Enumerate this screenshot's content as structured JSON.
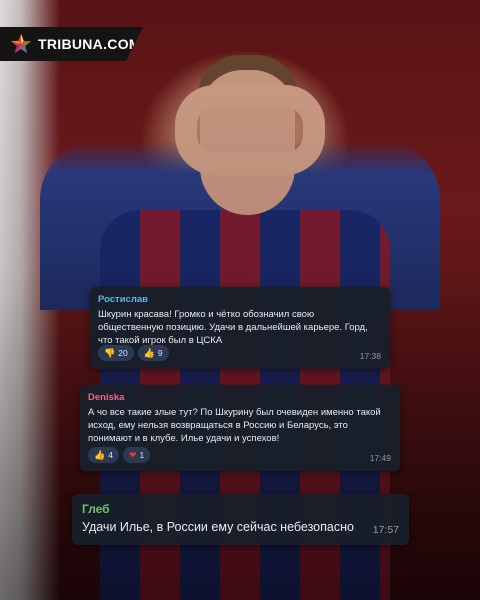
{
  "brand": {
    "name": "TRIBUNA.COM"
  },
  "messages": [
    {
      "author": "Ростислав",
      "author_color": "#5fb7e6",
      "text": "Шкурин красава! Громко и чётко обозначил свою общественную позицию. Удачи в дальнейшей карьере. Горд, что такой игрок был в ЦСКА",
      "reactions": [
        {
          "icon": "thumbs-down-icon",
          "glyph": "👎",
          "count": "20"
        },
        {
          "icon": "thumbs-up-icon",
          "glyph": "👍",
          "count": "9"
        }
      ],
      "time": "17:38"
    },
    {
      "author": "Deniska",
      "author_color": "#e86a8a",
      "text": "А чо все такие злые тут? По Шкурину был очевиден именно такой исход, ему нельзя возвращаться в Россию и Беларусь, это понимают и в клубе. Илье удачи и успехов!",
      "reactions": [
        {
          "icon": "thumbs-up-icon",
          "glyph": "👍",
          "count": "4"
        },
        {
          "icon": "heart-icon",
          "glyph": "❤",
          "count": "1"
        }
      ],
      "time": "17:49"
    },
    {
      "author": "Глеб",
      "author_color": "#6cc46a",
      "text": "Удачи Илье, в России ему сейчас небезопасно",
      "time": "17:57"
    }
  ],
  "colors": {
    "background": "#6b1719",
    "bubble": "#181f2a",
    "reaction_chip": "#2b3a52"
  }
}
